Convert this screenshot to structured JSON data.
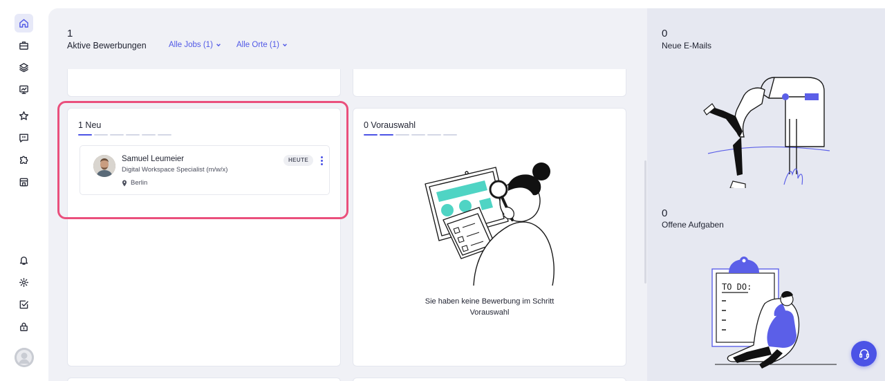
{
  "sidebar": {
    "items": [
      {
        "icon": "home-icon",
        "active": true
      },
      {
        "icon": "briefcase-icon"
      },
      {
        "icon": "layers-icon"
      },
      {
        "icon": "presentation-chart-icon"
      },
      {
        "icon": "star-icon"
      },
      {
        "icon": "message-square-icon"
      },
      {
        "icon": "puzzle-icon"
      },
      {
        "icon": "store-icon"
      },
      {
        "icon": "bell-icon"
      },
      {
        "icon": "gear-icon"
      },
      {
        "icon": "checkbox-icon"
      },
      {
        "icon": "lock-icon"
      }
    ]
  },
  "header": {
    "active_count": "1",
    "active_label": "Aktive Bewerbungen",
    "filter_jobs": "Alle Jobs (1)",
    "filter_locations": "Alle Orte (1)"
  },
  "columns": [
    {
      "title": "1 Neu",
      "progress_active": 1,
      "progress_total": 6
    },
    {
      "title": "0 Vorauswahl",
      "progress_active": 2,
      "progress_total": 6
    }
  ],
  "candidate": {
    "name": "Samuel Leumeier",
    "role": "Digital Workspace Specialist (m/w/x)",
    "location": "Berlin",
    "badge": "HEUTE"
  },
  "empty_state": {
    "line1": "Sie haben keine Bewerbung im Schritt",
    "line2": "Vorauswahl"
  },
  "right_panel": {
    "emails_count": "0",
    "emails_label": "Neue E-Mails",
    "tasks_count": "0",
    "tasks_label": "Offene Aufgaben",
    "todo_text": "TO DO:"
  },
  "colors": {
    "accent": "#4b53e6",
    "highlight": "#ea4f7c",
    "teal": "#4fd4c4"
  }
}
